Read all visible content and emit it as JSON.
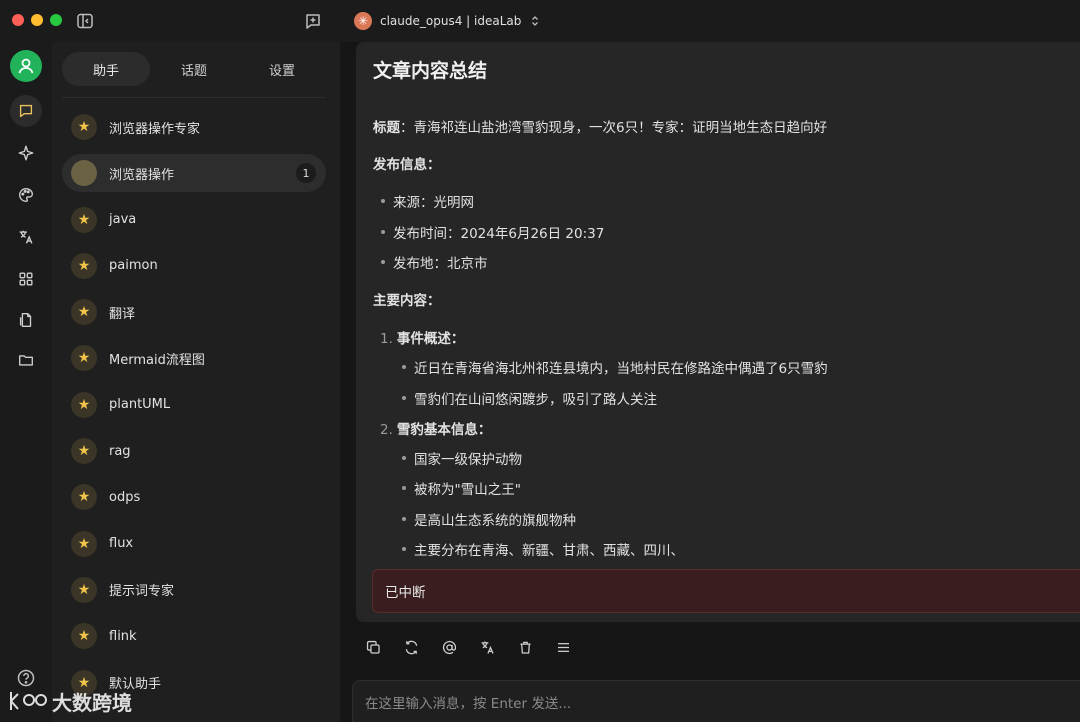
{
  "window": {
    "model_selector": "claude_opus4 | ideaLab"
  },
  "sidebar": {
    "tabs": [
      "助手",
      "话题",
      "设置"
    ],
    "active_tab": 0,
    "items": [
      {
        "label": "浏览器操作专家"
      },
      {
        "label": "浏览器操作",
        "badge": "1"
      },
      {
        "label": "java"
      },
      {
        "label": "paimon"
      },
      {
        "label": "翻译"
      },
      {
        "label": "Mermaid流程图"
      },
      {
        "label": "plantUML"
      },
      {
        "label": "rag"
      },
      {
        "label": "odps"
      },
      {
        "label": "flux"
      },
      {
        "label": "提示词专家"
      },
      {
        "label": "flink"
      },
      {
        "label": "默认助手"
      }
    ],
    "active_item": 1,
    "watermark": "大数跨境"
  },
  "message": {
    "title": "文章内容总结",
    "headline_label": "标题",
    "headline": "：青海祁连山盐池湾雪豹现身，一次6只！专家：证明当地生态日趋向好",
    "publish_label": "发布信息",
    "publish": [
      "来源：光明网",
      "发布时间：2024年6月26日 20:37",
      "发布地：北京市"
    ],
    "main_label": "主要内容",
    "sections": [
      {
        "num": "1.",
        "title": "事件概述",
        "bullets": [
          "近日在青海省海北州祁连县境内，当地村民在修路途中偶遇了6只雪豹",
          "雪豹们在山间悠闲踱步，吸引了路人关注"
        ]
      },
      {
        "num": "2.",
        "title": "雪豹基本信息",
        "bullets": [
          "国家一级保护动物",
          "被称为\"雪山之王\"",
          "是高山生态系统的旗舰物种",
          "主要分布在青海、新疆、甘肃、西藏、四川、"
        ]
      }
    ],
    "colon": "：",
    "interrupted": "已中断"
  },
  "input": {
    "placeholder": "在这里输入消息，按 Enter 发送..."
  },
  "colors": {
    "accent_green": "#22b35a",
    "interrupted_bg": "#3a1d1e",
    "star": "#f1c24a"
  }
}
